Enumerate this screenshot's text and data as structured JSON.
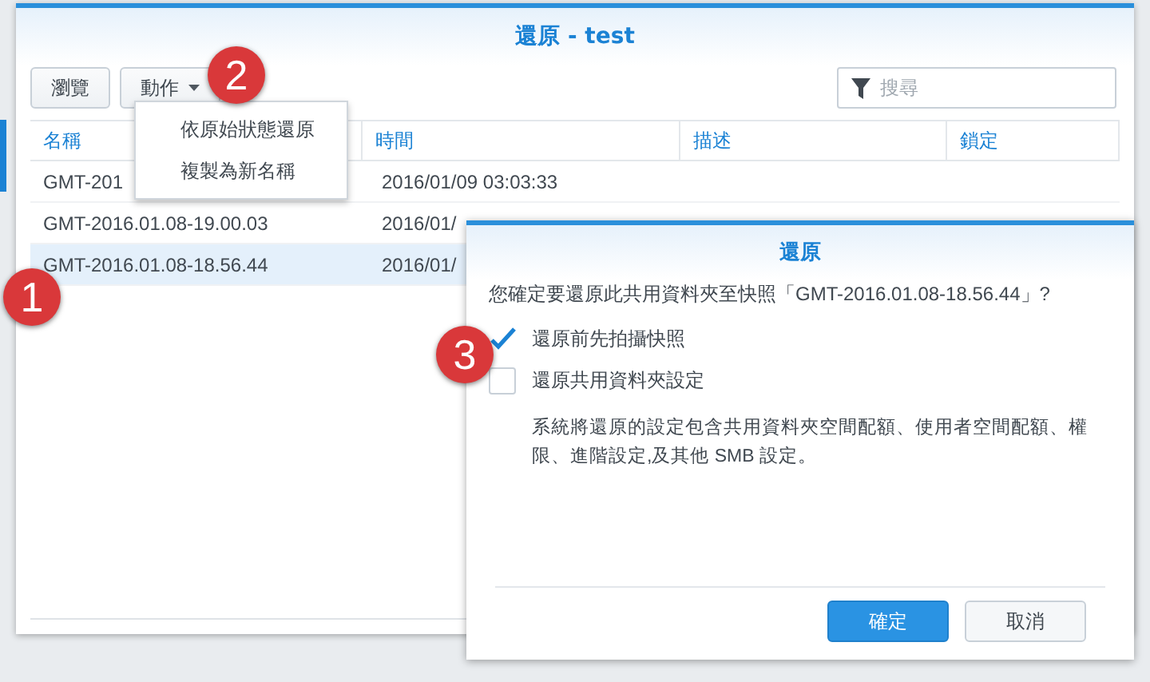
{
  "window": {
    "title": "還原 - test"
  },
  "toolbar": {
    "buttons": [
      {
        "label": "瀏覽"
      },
      {
        "label": "動作"
      }
    ],
    "search": {
      "placeholder": "搜尋"
    }
  },
  "action_menu": {
    "items": [
      {
        "label": "依原始狀態還原"
      },
      {
        "label": "複製為新名稱"
      }
    ]
  },
  "table": {
    "columns": [
      "名稱",
      "時間",
      "描述",
      "鎖定"
    ],
    "rows": [
      {
        "name": "GMT-201",
        "time": "2016/01/09 03:03:33",
        "selected": false
      },
      {
        "name": "GMT-2016.01.08-19.00.03",
        "time": "2016/01/",
        "selected": false
      },
      {
        "name": "GMT-2016.01.08-18.56.44",
        "time": "2016/01/",
        "selected": true
      }
    ]
  },
  "callouts": [
    "1",
    "2",
    "3"
  ],
  "dialog": {
    "title": "還原",
    "question": "您確定要還原此共用資料夾至快照「GMT-2016.01.08-18.56.44」?",
    "options": [
      {
        "label": "還原前先拍攝快照",
        "checked": true
      },
      {
        "label": "還原共用資料夾設定",
        "checked": false
      }
    ],
    "note": "系統將還原的設定包含共用資料夾空間配額、使用者空間配額、權限、進階設定,及其他 SMB 設定。",
    "buttons": [
      {
        "label": "確定",
        "kind": "primary"
      },
      {
        "label": "取消",
        "kind": "secondary"
      }
    ]
  }
}
